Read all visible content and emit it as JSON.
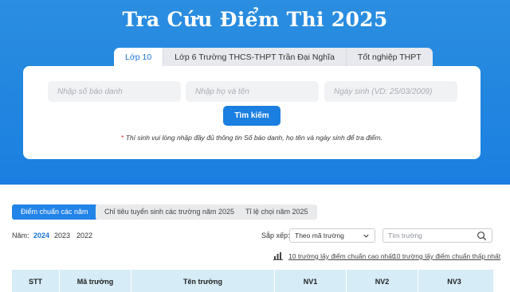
{
  "header": {
    "title": "Tra Cứu Điểm Thi 2025"
  },
  "tabs": [
    {
      "label": "Lớp 10",
      "active": true
    },
    {
      "label": "Lớp 6 Trường THCS-THPT Trần Đại Nghĩa",
      "active": false
    },
    {
      "label": "Tốt nghiệp THPT",
      "active": false
    }
  ],
  "search": {
    "sbd_placeholder": "Nhập số báo danh",
    "name_placeholder": "Nhập họ và tên",
    "dob_placeholder": "Ngày sinh (VD: 25/03/2009)",
    "button_label": "Tìm kiếm",
    "note_star": "*",
    "note_text": " Thí sinh vui lòng nhập đầy đủ thông tin Số báo danh, họ tên và ngày sinh để tra điểm."
  },
  "section_tabs": [
    {
      "label": "Điểm chuẩn các năm",
      "active": true
    },
    {
      "label": "Chỉ tiêu tuyển sinh các trường năm 2025",
      "active": false
    },
    {
      "label": "Tỉ lệ chọi năm 2025",
      "active": false
    }
  ],
  "filters": {
    "year_label": "Năm:",
    "years": [
      "2024",
      "2023",
      "2022"
    ],
    "selected_year": "2024",
    "sort_label": "Sắp xếp:",
    "sort_value": "Theo mã trường",
    "school_search_placeholder": "Tìm trường"
  },
  "links": {
    "top_high": "10 trường lấy điểm chuẩn cao nhất",
    "top_low": "10 trường lấy điểm chuẩn thấp nhất"
  },
  "table": {
    "headers": [
      "STT",
      "Mã trường",
      "Tên trường",
      "NV1",
      "NV2",
      "NV3"
    ]
  },
  "colors": {
    "brand_blue": "#1a7fe0",
    "active_tab_text": "#1a73d9",
    "table_header_bg": "#d6ecf7",
    "note_star": "#e02424"
  },
  "icons": [
    "chevron-down-icon",
    "search-icon",
    "bar-chart-icon"
  ]
}
